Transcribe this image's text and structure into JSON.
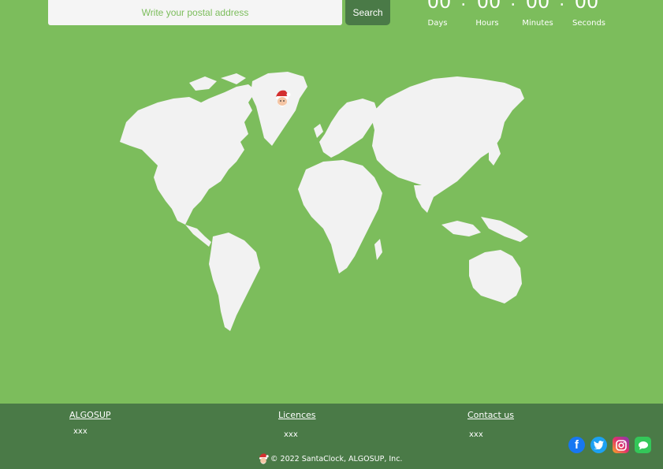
{
  "search": {
    "placeholder": "Write your postal address",
    "button_label": "Search"
  },
  "countdown": {
    "days": "00",
    "hours": "00",
    "minutes": "00",
    "seconds": "00",
    "separator": ":",
    "days_label": "Days",
    "hours_label": "Hours",
    "minutes_label": "Minutes",
    "seconds_label": "Seconds"
  },
  "map": {
    "marker_icon": "santa-icon"
  },
  "footer": {
    "col1": {
      "title": "ALGOSUP",
      "text": "xxx"
    },
    "col2": {
      "title": "Licences",
      "text": "xxx"
    },
    "col3": {
      "title": "Contact us",
      "text": "xxx"
    },
    "copyright": "© 2022 SantaClock, ALGOSUP, Inc.",
    "social": [
      "facebook-icon",
      "twitter-icon",
      "instagram-icon",
      "messages-icon"
    ]
  },
  "colors": {
    "background": "#7cbd5c",
    "footer": "#4a7a47",
    "map_land": "#f2f2f2",
    "button": "#4a7a47"
  }
}
